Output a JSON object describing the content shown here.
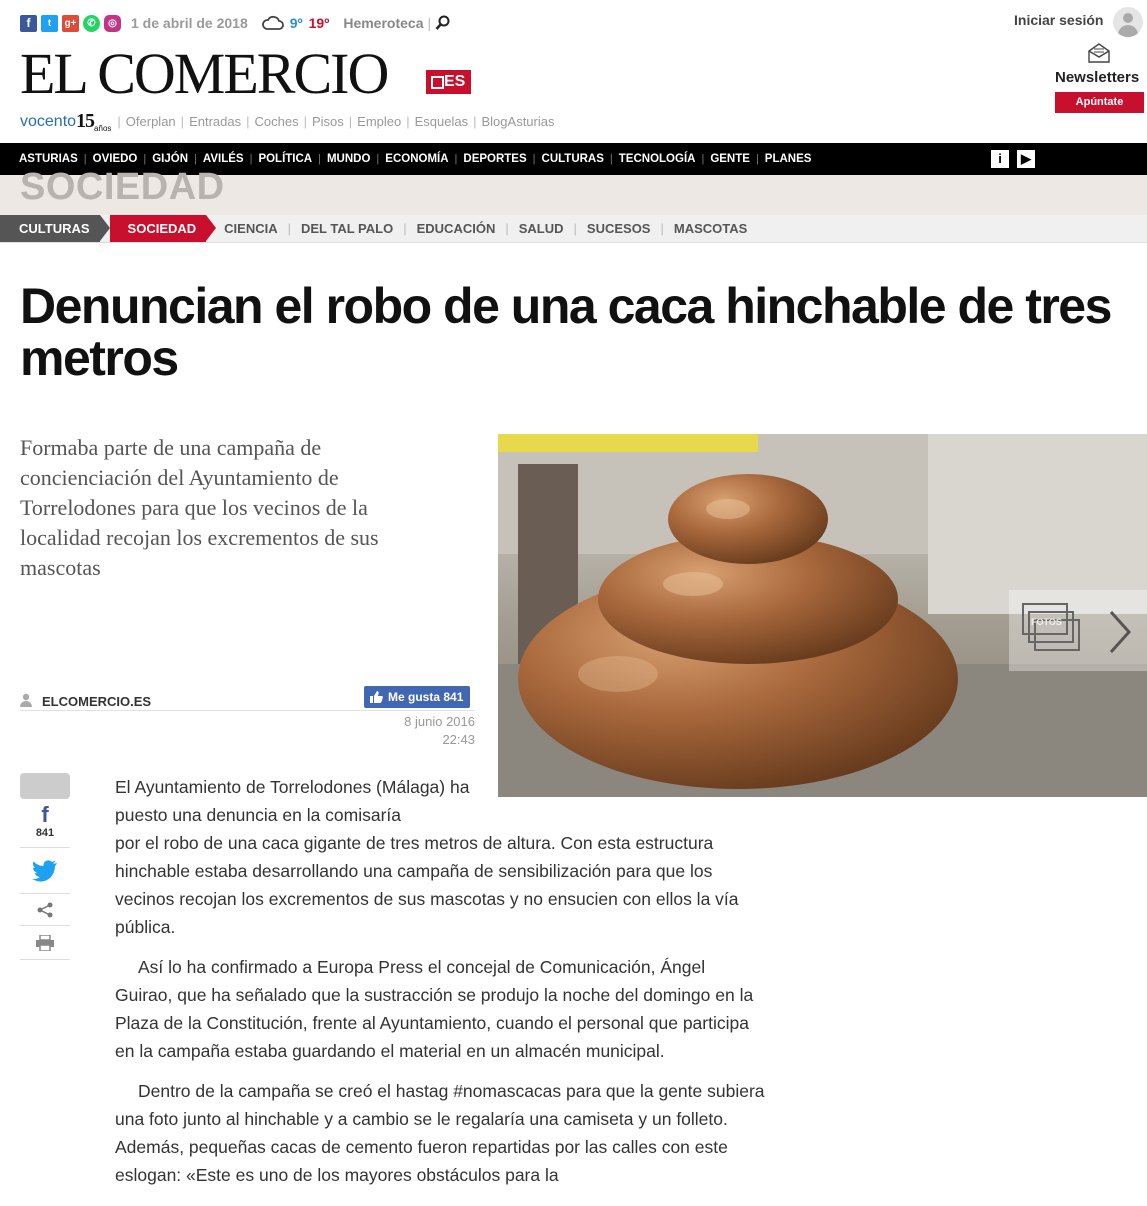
{
  "topbar": {
    "date": "1 de abril de 2018",
    "temp_min": "9º",
    "temp_max": "19º",
    "hemeroteca": "Hemeroteca"
  },
  "brand": {
    "logo": "EL COMERCIO",
    "logo_suffix": "ES",
    "vocento": "vocento",
    "vocento_15": "15",
    "vocento_anos": "años",
    "links": [
      "Oferplan",
      "Entradas",
      "Coches",
      "Pisos",
      "Empleo",
      "Esquelas",
      "BlogAsturias"
    ]
  },
  "user": {
    "login": "Iniciar sesión",
    "newsletters": "Newsletters",
    "signup": "Apúntate"
  },
  "mainnav": [
    "ASTURIAS",
    "OVIEDO",
    "GIJÓN",
    "AVILÉS",
    "POLÍTICA",
    "MUNDO",
    "ECONOMÍA",
    "DEPORTES",
    "CULTURAS",
    "TECNOLOGÍA",
    "GENTE",
    "PLANES"
  ],
  "section": {
    "title": "SOCIEDAD",
    "parent": "CULTURAS",
    "current": "SOCIEDAD",
    "subnav": [
      "CIENCIA",
      "DEL TAL PALO",
      "EDUCACIÓN",
      "SALUD",
      "SUCESOS",
      "MASCOTAS"
    ]
  },
  "article": {
    "headline": "Denuncian el robo de una caca hinchable de tres metros",
    "subtitle": "Formaba parte de una campaña de concienciación del Ayuntamiento de Torrelodones para que los vecinos de la localidad recojan los excrementos de sus mascotas",
    "author": "ELCOMERCIO.ES",
    "like_label": "Me gusta 841",
    "date": "8 junio 2016",
    "time": "22:43",
    "fb_count": "841",
    "fotos_label": "FOTOS",
    "p1a": "El Ayuntamiento de Torrelodones (Málaga) ha puesto una denuncia en la comisaría",
    "p1b": "por el robo de una caca gigante de tres metros de altura. Con esta estructura hinchable estaba desarrollando una campaña de sensibilización para que los vecinos recojan los excrementos de sus mascotas y no ensucien con ellos la vía pública.",
    "p2": "Así lo ha confirmado a Europa Press el concejal de Comunicación, Ángel Guirao, que ha señalado que la sustracción se produjo la noche del domingo en la Plaza de la Constitución, frente al Ayuntamiento, cuando el personal que participa en la campaña estaba guardando el material en un almacén municipal.",
    "p3": "Dentro de la campaña se creó el hastag #nomascacas para que la gente subiera una foto junto al hinchable y a cambio se le regalaría una camiseta y un folleto. Además, pequeñas cacas de cemento fueron repartidas por las calles con este eslogan: «Este es uno de los mayores obstáculos para la"
  }
}
